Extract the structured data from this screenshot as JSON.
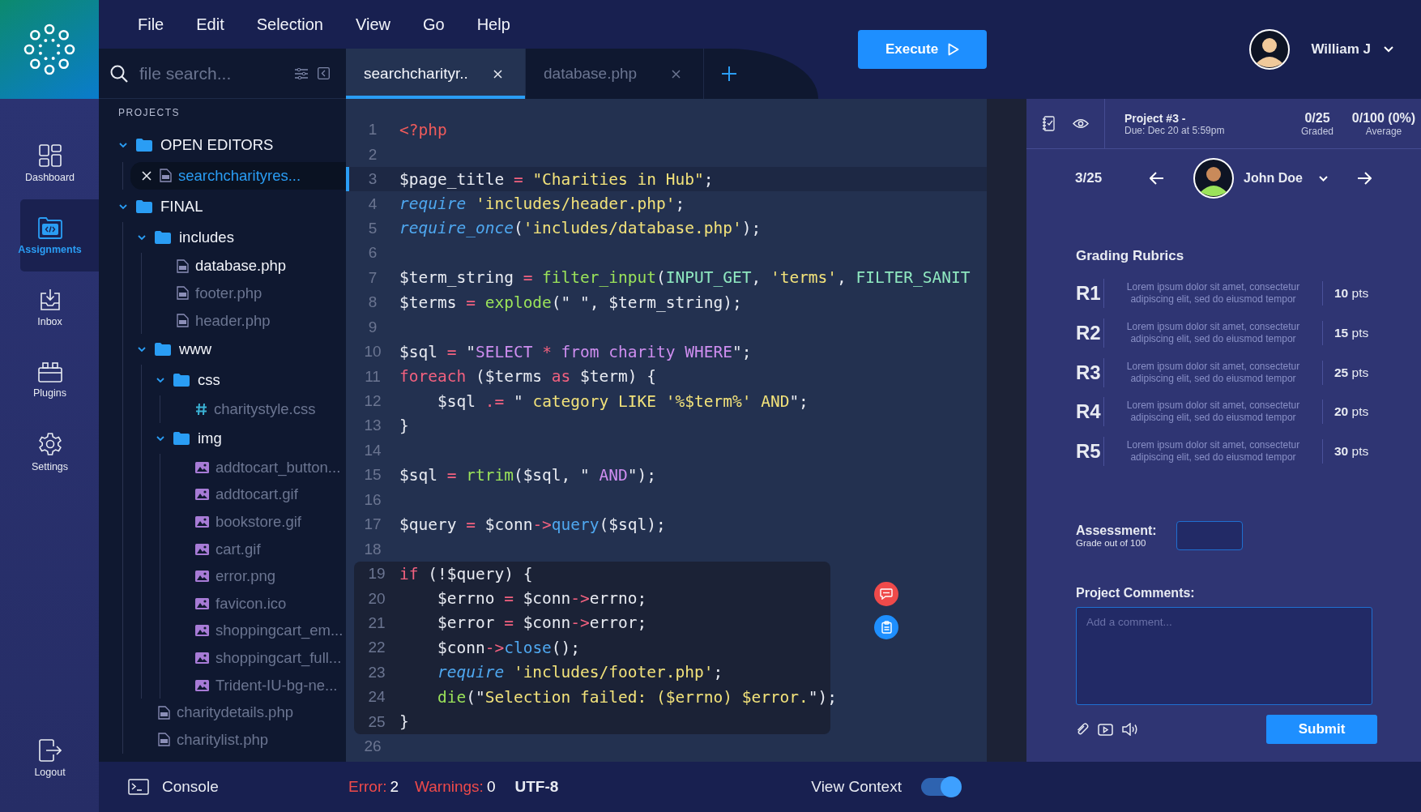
{
  "menu": [
    "File",
    "Edit",
    "Selection",
    "View",
    "Go",
    "Help"
  ],
  "nav": [
    {
      "label": "Dashboard",
      "kind": "dashboard",
      "selected": false
    },
    {
      "label": "Assignments",
      "kind": "assignments",
      "selected": true
    },
    {
      "label": "Inbox",
      "kind": "inbox",
      "selected": false
    },
    {
      "label": "Plugins",
      "kind": "plugins",
      "selected": false
    },
    {
      "label": "Settings",
      "kind": "settings",
      "selected": false
    }
  ],
  "logout": {
    "label": "Logout"
  },
  "search": {
    "placeholder": "file search..."
  },
  "tabs": [
    {
      "label": "searchcharityr..",
      "selected": true
    },
    {
      "label": "database.php",
      "selected": false
    }
  ],
  "execute": {
    "label": "Execute"
  },
  "user": {
    "name": "William J"
  },
  "tree": {
    "heading": "PROJECTS",
    "items": [
      {
        "label": "OPEN EDITORS",
        "kind": "folder",
        "expanded": true,
        "children": [
          {
            "label": "searchcharityres...",
            "kind": "php",
            "selected": true
          }
        ]
      },
      {
        "label": "FINAL",
        "kind": "folder",
        "expanded": true,
        "children": [
          {
            "label": "includes",
            "kind": "folder",
            "expanded": true,
            "children": [
              {
                "label": "database.php",
                "kind": "php",
                "selected": false,
                "open": true
              },
              {
                "label": "footer.php",
                "kind": "php",
                "selected": false,
                "open": false
              },
              {
                "label": "header.php",
                "kind": "php",
                "selected": false,
                "open": false
              }
            ]
          },
          {
            "label": "www",
            "kind": "folder",
            "expanded": true,
            "children": [
              {
                "label": "css",
                "kind": "folder",
                "expanded": true,
                "children": [
                  {
                    "label": "charitystyle.css",
                    "kind": "css",
                    "selected": false,
                    "open": false
                  }
                ]
              },
              {
                "label": "img",
                "kind": "folder",
                "expanded": true,
                "children": [
                  {
                    "label": "addtocart_button...",
                    "kind": "image",
                    "selected": false,
                    "open": false
                  },
                  {
                    "label": "addtocart.gif",
                    "kind": "image",
                    "selected": false,
                    "open": false
                  },
                  {
                    "label": "bookstore.gif",
                    "kind": "image",
                    "selected": false,
                    "open": false
                  },
                  {
                    "label": "cart.gif",
                    "kind": "image",
                    "selected": false,
                    "open": false
                  },
                  {
                    "label": "error.png",
                    "kind": "image",
                    "selected": false,
                    "open": false
                  },
                  {
                    "label": "favicon.ico",
                    "kind": "image",
                    "selected": false,
                    "open": false
                  },
                  {
                    "label": "shoppingcart_em...",
                    "kind": "image",
                    "selected": false,
                    "open": false
                  },
                  {
                    "label": "shoppingcart_full...",
                    "kind": "image",
                    "selected": false,
                    "open": false
                  },
                  {
                    "label": "Trident-IU-bg-ne...",
                    "kind": "image",
                    "selected": false,
                    "open": false
                  }
                ]
              }
            ]
          },
          {
            "label": "charitydetails.php",
            "kind": "php",
            "selected": false,
            "open": false
          },
          {
            "label": "charitylist.php",
            "kind": "php",
            "selected": false,
            "open": false
          }
        ]
      }
    ]
  },
  "editor": {
    "lines": [
      {
        "n": "1",
        "current": false,
        "marked": false,
        "tokens": [
          {
            "kind": "tag",
            "text": "<?php"
          }
        ]
      },
      {
        "n": "2",
        "current": false,
        "marked": false
      },
      {
        "n": "3",
        "current": true,
        "marked": false,
        "tokens": [
          {
            "kind": "var",
            "text": "$page_title "
          },
          {
            "kind": "op",
            "text": "= "
          },
          {
            "kind": "str",
            "text": "\"Charities in Hub\""
          },
          {
            "kind": "punct",
            "text": ";"
          }
        ]
      },
      {
        "n": "4",
        "current": false,
        "marked": false,
        "tokens": [
          {
            "kind": "inc",
            "text": "require "
          },
          {
            "kind": "str",
            "text": "'includes/header.php'"
          },
          {
            "kind": "punct",
            "text": ";"
          }
        ]
      },
      {
        "n": "5",
        "current": false,
        "marked": false,
        "tokens": [
          {
            "kind": "inc",
            "text": "require_once"
          },
          {
            "kind": "punct",
            "text": "("
          },
          {
            "kind": "str",
            "text": "'includes/database.php'"
          },
          {
            "kind": "punct",
            "text": ");"
          }
        ]
      },
      {
        "n": "6",
        "current": false,
        "marked": false
      },
      {
        "n": "7",
        "current": false,
        "marked": false,
        "tokens": [
          {
            "kind": "var",
            "text": "$term_string "
          },
          {
            "kind": "op",
            "text": "= "
          },
          {
            "kind": "func",
            "text": "filter_input"
          },
          {
            "kind": "punct",
            "text": "("
          },
          {
            "kind": "const",
            "text": "INPUT_GET"
          },
          {
            "kind": "punct",
            "text": ", "
          },
          {
            "kind": "str",
            "text": "'terms'"
          },
          {
            "kind": "punct",
            "text": ", "
          },
          {
            "kind": "const",
            "text": "FILTER_SANIT"
          }
        ]
      },
      {
        "n": "8",
        "current": false,
        "marked": false,
        "tokens": [
          {
            "kind": "var",
            "text": "$terms "
          },
          {
            "kind": "op",
            "text": "= "
          },
          {
            "kind": "func",
            "text": "explode"
          },
          {
            "kind": "punct",
            "text": "(\" \", $term_string);"
          }
        ]
      },
      {
        "n": "9",
        "current": false,
        "marked": false
      },
      {
        "n": "10",
        "current": false,
        "marked": false,
        "tokens": [
          {
            "kind": "var",
            "text": "$sql "
          },
          {
            "kind": "op",
            "text": "= "
          },
          {
            "kind": "punct",
            "text": "\""
          },
          {
            "kind": "sql",
            "text": "SELECT "
          },
          {
            "kind": "op",
            "text": "*"
          },
          {
            "kind": "sql",
            "text": " from charity WHERE"
          },
          {
            "kind": "punct",
            "text": "\";"
          }
        ]
      },
      {
        "n": "11",
        "current": false,
        "marked": false,
        "tokens": [
          {
            "kind": "kw",
            "text": "foreach "
          },
          {
            "kind": "punct",
            "text": "($terms "
          },
          {
            "kind": "kw",
            "text": "as "
          },
          {
            "kind": "punct",
            "text": "$term) {"
          }
        ]
      },
      {
        "n": "12",
        "current": false,
        "marked": false,
        "tokens": [
          {
            "kind": "var",
            "text": "    $sql "
          },
          {
            "kind": "op",
            "text": ".= "
          },
          {
            "kind": "punct",
            "text": "\" "
          },
          {
            "kind": "str",
            "text": "category LIKE '%$term%' AND"
          },
          {
            "kind": "punct",
            "text": "\";"
          }
        ]
      },
      {
        "n": "13",
        "current": false,
        "marked": false,
        "tokens": [
          {
            "kind": "punct",
            "text": "}"
          }
        ]
      },
      {
        "n": "14",
        "current": false,
        "marked": false
      },
      {
        "n": "15",
        "current": false,
        "marked": false,
        "tokens": [
          {
            "kind": "var",
            "text": "$sql "
          },
          {
            "kind": "op",
            "text": "= "
          },
          {
            "kind": "func",
            "text": "rtrim"
          },
          {
            "kind": "punct",
            "text": "($sql, \""
          },
          {
            "kind": "sql",
            "text": " AND"
          },
          {
            "kind": "punct",
            "text": "\");"
          }
        ]
      },
      {
        "n": "16",
        "current": false,
        "marked": false
      },
      {
        "n": "17",
        "current": false,
        "marked": false,
        "tokens": [
          {
            "kind": "var",
            "text": "$query "
          },
          {
            "kind": "op",
            "text": "= "
          },
          {
            "kind": "punct",
            "text": "$conn"
          },
          {
            "kind": "op",
            "text": "->"
          },
          {
            "kind": "method",
            "text": "query"
          },
          {
            "kind": "punct",
            "text": "($sql);"
          }
        ]
      },
      {
        "n": "18",
        "current": false,
        "marked": false
      },
      {
        "n": "19",
        "current": false,
        "marked": true,
        "tokens": [
          {
            "kind": "kw",
            "text": "if "
          },
          {
            "kind": "punct",
            "text": "(!$query) {"
          }
        ]
      },
      {
        "n": "20",
        "current": false,
        "marked": true,
        "tokens": [
          {
            "kind": "var",
            "text": "    $errno "
          },
          {
            "kind": "op",
            "text": "= "
          },
          {
            "kind": "punct",
            "text": "$conn"
          },
          {
            "kind": "op",
            "text": "->"
          },
          {
            "kind": "punct",
            "text": "errno;"
          }
        ]
      },
      {
        "n": "21",
        "current": false,
        "marked": true,
        "tokens": [
          {
            "kind": "var",
            "text": "    $error "
          },
          {
            "kind": "op",
            "text": "= "
          },
          {
            "kind": "punct",
            "text": "$conn"
          },
          {
            "kind": "op",
            "text": "->"
          },
          {
            "kind": "punct",
            "text": "error;"
          }
        ]
      },
      {
        "n": "22",
        "current": false,
        "marked": true,
        "tokens": [
          {
            "kind": "var",
            "text": "    $conn"
          },
          {
            "kind": "op",
            "text": "->"
          },
          {
            "kind": "method",
            "text": "close"
          },
          {
            "kind": "punct",
            "text": "();"
          }
        ]
      },
      {
        "n": "23",
        "current": false,
        "marked": true,
        "tokens": [
          {
            "kind": "inc",
            "text": "    require "
          },
          {
            "kind": "str",
            "text": "'includes/footer.php'"
          },
          {
            "kind": "punct",
            "text": ";"
          }
        ]
      },
      {
        "n": "24",
        "current": false,
        "marked": true,
        "tokens": [
          {
            "kind": "func",
            "text": "    die"
          },
          {
            "kind": "punct",
            "text": "(\""
          },
          {
            "kind": "str",
            "text": "Selection failed: ($errno) $error."
          },
          {
            "kind": "punct",
            "text": "\");"
          }
        ]
      },
      {
        "n": "25",
        "current": false,
        "marked": true,
        "tokens": [
          {
            "kind": "punct",
            "text": "}"
          }
        ]
      },
      {
        "n": "26",
        "current": false,
        "marked": false
      }
    ]
  },
  "grading": {
    "project": "Project #3 -",
    "due": "Due: Dec 20 at 5:59pm",
    "graded": "0/25",
    "graded_label": "Graded",
    "average": "0/100 (0%)",
    "average_label": "Average",
    "position": "3/25",
    "student": "John Doe",
    "rubrics_title": "Grading Rubrics",
    "rubrics": [
      {
        "id": "R1",
        "description": "Lorem ipsum dolor sit amet, consectetur adipiscing elit, sed do eiusmod tempor",
        "points": "**10** pts"
      },
      {
        "id": "R2",
        "description": "Lorem ipsum dolor sit amet, consectetur adipiscing elit, sed do eiusmod tempor",
        "points": "**15** pts"
      },
      {
        "id": "R3",
        "description": "Lorem ipsum dolor sit amet, consectetur adipiscing elit, sed do eiusmod tempor",
        "points": "**25** pts"
      },
      {
        "id": "R4",
        "description": "Lorem ipsum dolor sit amet, consectetur adipiscing elit, sed do eiusmod tempor",
        "points": "**20** pts"
      },
      {
        "id": "R5",
        "description": "Lorem ipsum dolor sit amet, consectetur adipiscing elit, sed do eiusmod tempor",
        "points": "**30** pts"
      }
    ],
    "assessment_label": "Assessment:",
    "assessment_hint": "Grade out of 100",
    "comments_label": "Project Comments:",
    "comment_placeholder": "Add a comment...",
    "submit": "Submit"
  },
  "status_bar": {
    "console": "Console",
    "error_label": "Error:",
    "error_count": "2",
    "warnings_label": "Warnings:",
    "warnings_count": "0",
    "encoding": "UTF-8",
    "view_context": {
      "label": "View Context",
      "on": true
    }
  }
}
